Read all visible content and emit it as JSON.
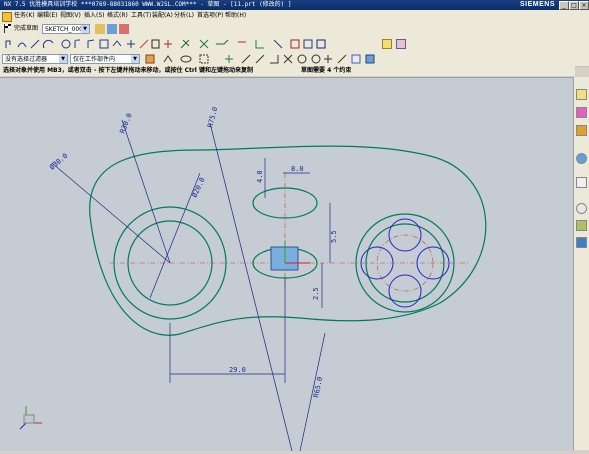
{
  "window": {
    "title": "NX 7.5 优胜模具培训学校  ***0769-88031860  WWW.WJSL.COM***  - 草图 - [11.prt (修改的) ]",
    "brand": "SIEMENS"
  },
  "menu": [
    "任务(K)",
    "编辑(E)",
    "视图(V)",
    "插入(S)",
    "格式(R)",
    "工具(T)",
    "装配(A)",
    "分析(L)",
    "首选项(P)",
    "帮助(H)"
  ],
  "sketch_toolbar": {
    "finish_label": "完成草图",
    "sketch_name": "SKETCH_000"
  },
  "selection_bar": {
    "filter": "没有选择过滤器",
    "scope": "仅在工作部件内"
  },
  "hint_line": {
    "prompt": "选择对象并使用 MB3，或者双击 - 按下左键并拖动来移动，或按住 Ctrl 键和左键拖动来复制",
    "status": "草图需要 4 个约束"
  },
  "dimensions": {
    "d_r30": "R30.0",
    "d_r75": "R75.0",
    "d_dia30": "Ø30.0",
    "d_dia20": "Ø20.0",
    "d_4": "4.0",
    "d_8": "8.0",
    "d_5_5": "5.5",
    "d_2_5": "2.5",
    "d_29": "29.0",
    "d_r65": "R65.0"
  },
  "colors": {
    "geometry": "#007a5a",
    "circles": "#2222cc",
    "dimension": "#1a2a8a",
    "background": "#c6ccd4",
    "titlebar": "#0a2d6a"
  },
  "icons": {
    "finish": "flag-icon",
    "triad": "csys-triad-icon"
  }
}
